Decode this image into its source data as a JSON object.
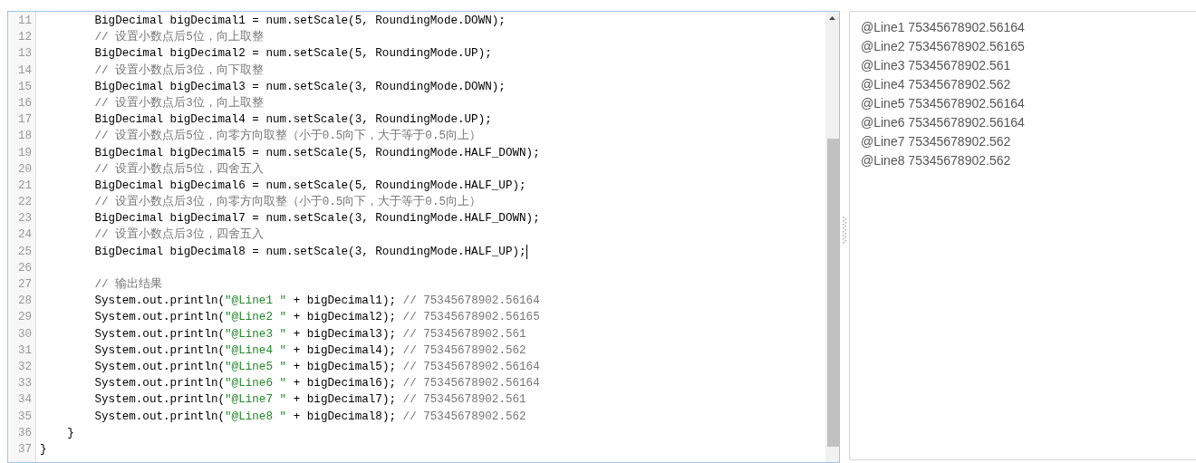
{
  "editor": {
    "lines": [
      {
        "number": "11",
        "cursor": false,
        "segments": [
          {
            "kind": "code",
            "text": "        BigDecimal bigDecimal1 = num.setScale(5, RoundingMode.DOWN);"
          }
        ]
      },
      {
        "number": "12",
        "cursor": false,
        "segments": [
          {
            "kind": "comment",
            "text": "        // 设置小数点后5位，向上取整"
          }
        ]
      },
      {
        "number": "13",
        "cursor": false,
        "segments": [
          {
            "kind": "code",
            "text": "        BigDecimal bigDecimal2 = num.setScale(5, RoundingMode.UP);"
          }
        ]
      },
      {
        "number": "14",
        "cursor": false,
        "segments": [
          {
            "kind": "comment",
            "text": "        // 设置小数点后3位，向下取整"
          }
        ]
      },
      {
        "number": "15",
        "cursor": false,
        "segments": [
          {
            "kind": "code",
            "text": "        BigDecimal bigDecimal3 = num.setScale(3, RoundingMode.DOWN);"
          }
        ]
      },
      {
        "number": "16",
        "cursor": false,
        "segments": [
          {
            "kind": "comment",
            "text": "        // 设置小数点后3位，向上取整"
          }
        ]
      },
      {
        "number": "17",
        "cursor": false,
        "segments": [
          {
            "kind": "code",
            "text": "        BigDecimal bigDecimal4 = num.setScale(3, RoundingMode.UP);"
          }
        ]
      },
      {
        "number": "18",
        "cursor": false,
        "segments": [
          {
            "kind": "comment",
            "text": "        // 设置小数点后5位，向零方向取整（小于0.5向下，大于等于0.5向上）"
          }
        ]
      },
      {
        "number": "19",
        "cursor": false,
        "segments": [
          {
            "kind": "code",
            "text": "        BigDecimal bigDecimal5 = num.setScale(5, RoundingMode.HALF_DOWN);"
          }
        ]
      },
      {
        "number": "20",
        "cursor": false,
        "segments": [
          {
            "kind": "comment",
            "text": "        // 设置小数点后5位，四舍五入"
          }
        ]
      },
      {
        "number": "21",
        "cursor": false,
        "segments": [
          {
            "kind": "code",
            "text": "        BigDecimal bigDecimal6 = num.setScale(5, RoundingMode.HALF_UP);"
          }
        ]
      },
      {
        "number": "22",
        "cursor": false,
        "segments": [
          {
            "kind": "comment",
            "text": "        // 设置小数点后3位，向零方向取整（小于0.5向下，大于等于0.5向上）"
          }
        ]
      },
      {
        "number": "23",
        "cursor": false,
        "segments": [
          {
            "kind": "code",
            "text": "        BigDecimal bigDecimal7 = num.setScale(3, RoundingMode.HALF_DOWN);"
          }
        ]
      },
      {
        "number": "24",
        "cursor": false,
        "segments": [
          {
            "kind": "comment",
            "text": "        // 设置小数点后3位，四舍五入"
          }
        ]
      },
      {
        "number": "25",
        "cursor": true,
        "segments": [
          {
            "kind": "code",
            "text": "        BigDecimal bigDecimal8 = num.setScale(3, RoundingMode.HALF_UP);"
          }
        ]
      },
      {
        "number": "26",
        "cursor": false
      },
      {
        "number": "27",
        "cursor": false,
        "segments": [
          {
            "kind": "comment",
            "text": "        // 输出结果"
          }
        ]
      },
      {
        "number": "28",
        "cursor": false,
        "segments": [
          {
            "kind": "code",
            "text": "        System.out.println("
          },
          {
            "kind": "string",
            "text": "\"@Line1 \""
          },
          {
            "kind": "code",
            "text": " + bigDecimal1); "
          },
          {
            "kind": "comment",
            "text": "// 75345678902.56164"
          }
        ]
      },
      {
        "number": "29",
        "cursor": false,
        "segments": [
          {
            "kind": "code",
            "text": "        System.out.println("
          },
          {
            "kind": "string",
            "text": "\"@Line2 \""
          },
          {
            "kind": "code",
            "text": " + bigDecimal2); "
          },
          {
            "kind": "comment",
            "text": "// 75345678902.56165"
          }
        ]
      },
      {
        "number": "30",
        "cursor": false,
        "segments": [
          {
            "kind": "code",
            "text": "        System.out.println("
          },
          {
            "kind": "string",
            "text": "\"@Line3 \""
          },
          {
            "kind": "code",
            "text": " + bigDecimal3); "
          },
          {
            "kind": "comment",
            "text": "// 75345678902.561"
          }
        ]
      },
      {
        "number": "31",
        "cursor": false,
        "segments": [
          {
            "kind": "code",
            "text": "        System.out.println("
          },
          {
            "kind": "string",
            "text": "\"@Line4 \""
          },
          {
            "kind": "code",
            "text": " + bigDecimal4); "
          },
          {
            "kind": "comment",
            "text": "// 75345678902.562"
          }
        ]
      },
      {
        "number": "32",
        "cursor": false,
        "segments": [
          {
            "kind": "code",
            "text": "        System.out.println("
          },
          {
            "kind": "string",
            "text": "\"@Line5 \""
          },
          {
            "kind": "code",
            "text": " + bigDecimal5); "
          },
          {
            "kind": "comment",
            "text": "// 75345678902.56164"
          }
        ]
      },
      {
        "number": "33",
        "cursor": false,
        "segments": [
          {
            "kind": "code",
            "text": "        System.out.println("
          },
          {
            "kind": "string",
            "text": "\"@Line6 \""
          },
          {
            "kind": "code",
            "text": " + bigDecimal6); "
          },
          {
            "kind": "comment",
            "text": "// 75345678902.56164"
          }
        ]
      },
      {
        "number": "34",
        "cursor": false,
        "segments": [
          {
            "kind": "code",
            "text": "        System.out.println("
          },
          {
            "kind": "string",
            "text": "\"@Line7 \""
          },
          {
            "kind": "code",
            "text": " + bigDecimal7); "
          },
          {
            "kind": "comment",
            "text": "// 75345678902.561"
          }
        ]
      },
      {
        "number": "35",
        "cursor": false,
        "segments": [
          {
            "kind": "code",
            "text": "        System.out.println("
          },
          {
            "kind": "string",
            "text": "\"@Line8 \""
          },
          {
            "kind": "code",
            "text": " + bigDecimal8); "
          },
          {
            "kind": "comment",
            "text": "// 75345678902.562"
          }
        ]
      },
      {
        "number": "36",
        "cursor": false,
        "segments": [
          {
            "kind": "code",
            "text": "    }"
          }
        ]
      },
      {
        "number": "37",
        "cursor": false,
        "segments": [
          {
            "kind": "code",
            "text": "}"
          }
        ]
      }
    ]
  },
  "output": {
    "lines": [
      "@Line1 75345678902.56164",
      "@Line2 75345678902.56165",
      "@Line3 75345678902.561",
      "@Line4 75345678902.562",
      "@Line5 75345678902.56164",
      "@Line6 75345678902.56164",
      "@Line7 75345678902.562",
      "@Line8 75345678902.562"
    ]
  }
}
